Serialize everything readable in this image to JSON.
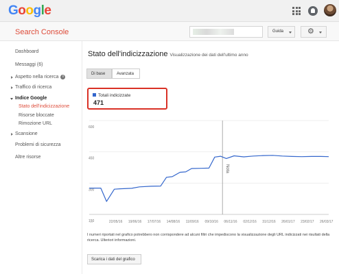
{
  "logo_text": "Google",
  "logo_colors": [
    "#4285f4",
    "#ea4335",
    "#fbbc05",
    "#4285f4",
    "#34a853",
    "#ea4335"
  ],
  "header": {
    "app_name": "Search Console",
    "guide_label": "Guida",
    "settings_icon": "gear-icon"
  },
  "sidebar": {
    "items": [
      {
        "label": "Dashboard"
      },
      {
        "label": "Messaggi (6)"
      },
      {
        "label": "Aspetto nella ricerca"
      },
      {
        "label": "Traffico di ricerca"
      },
      {
        "label": "Indice Google"
      },
      {
        "label": "Stato dell'indicizzazione"
      },
      {
        "label": "Risorse bloccate"
      },
      {
        "label": "Rimozione URL"
      },
      {
        "label": "Scansione"
      },
      {
        "label": "Problemi di sicurezza"
      },
      {
        "label": "Altre risorse"
      }
    ]
  },
  "main": {
    "title": "Stato dell'indicizzazione",
    "subtitle": "Visualizzazione dei dati dell'ultimo anno",
    "tabs": [
      {
        "label": "Di base"
      },
      {
        "label": "Avanzata"
      }
    ],
    "total_label": "Totali indicizzate",
    "total_value": "471",
    "note_text": "I numeri riportati nel grafico potrebbero non corrispondere ad alcuni filtri che impediscono la visualizzazione degli URL indicizzati nei risultati della ricerca. Ulteriori informazioni.",
    "download_label": "Scarica i dati del grafico"
  },
  "chart_data": {
    "type": "line",
    "ylim": [
      150,
      600
    ],
    "y_ticks": [
      "600",
      "450",
      "300",
      "150"
    ],
    "x_tick_labels": [
      "...",
      "22/05/16",
      "19/06/16",
      "17/07/16",
      "14/08/16",
      "11/09/16",
      "09/10/16",
      "06/11/16",
      "02/12/16",
      "31/12/16",
      "26/01/17",
      "23/02/17",
      "26/03/17"
    ],
    "annotation": "Nota",
    "annotation_x": 6.9,
    "color": "#3366cc",
    "series": [
      {
        "x": [
          0,
          0.6,
          0.9,
          1.3,
          1.6,
          2.2,
          2.6,
          3.2,
          3.7,
          4.0,
          4.3,
          4.7,
          5.0,
          5.3,
          5.8,
          6.2,
          6.5,
          6.8,
          7.1,
          7.5,
          8.0,
          8.5,
          9.0,
          9.5,
          10.0,
          10.5,
          11.0,
          11.5,
          12.0,
          12.4
        ],
        "y": [
          276,
          276,
          212,
          271,
          273,
          275,
          282,
          285,
          286,
          328,
          331,
          352,
          354,
          370,
          371,
          372,
          425,
          429,
          418,
          431,
          426,
          430,
          432,
          433,
          430,
          428,
          427,
          428,
          428,
          427
        ]
      }
    ]
  }
}
